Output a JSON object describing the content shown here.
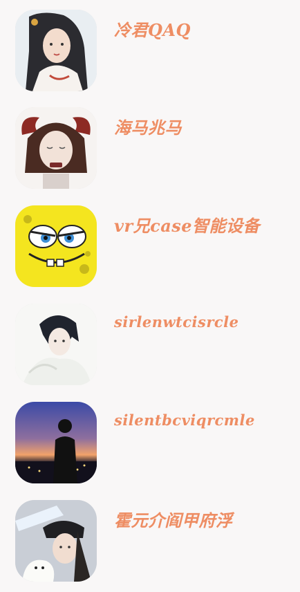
{
  "contacts": [
    {
      "name": "冷君QAQ",
      "avatar": "avatar-ancient-lady-icon"
    },
    {
      "name": "海马兆马",
      "avatar": "avatar-horned-girl-icon"
    },
    {
      "name": "vr兄case智能设备",
      "avatar": "avatar-spongebob-icon"
    },
    {
      "name": "sirlenwtcisrcle",
      "avatar": "avatar-anime-boy-icon"
    },
    {
      "name": "silentbcviqrcmle",
      "avatar": "avatar-sunset-silhouette-icon"
    },
    {
      "name": "霍元介阎甲府浮",
      "avatar": "avatar-girl-with-dog-icon"
    }
  ],
  "colors": {
    "name_text": "#ee8d63",
    "background": "#f9f7f7"
  }
}
